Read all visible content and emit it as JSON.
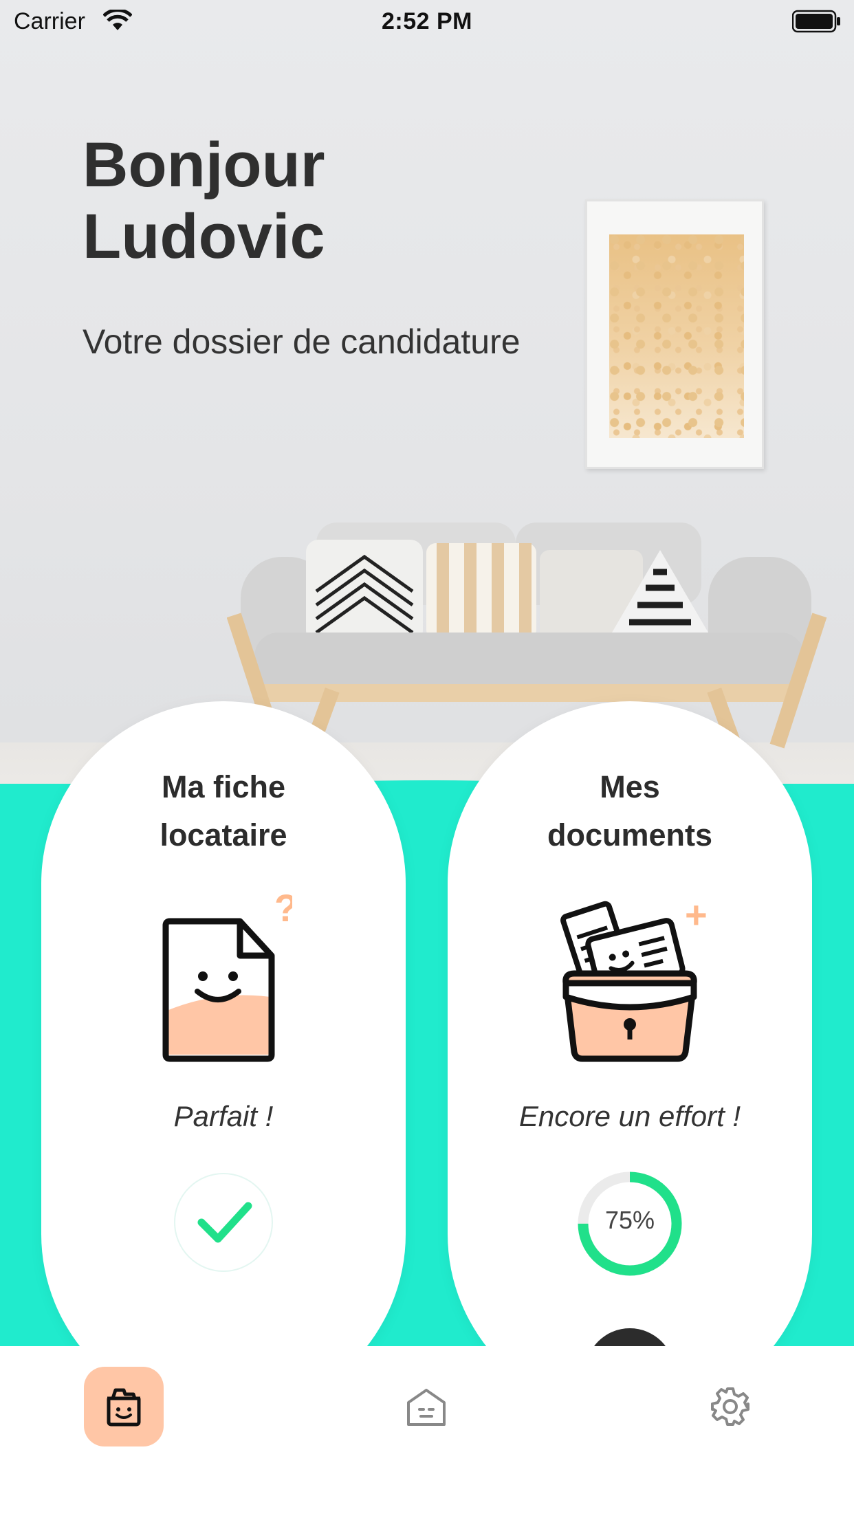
{
  "status_bar": {
    "carrier": "Carrier",
    "time": "2:52 PM"
  },
  "greeting": {
    "line1": "Bonjour",
    "line2": "Ludovic",
    "subtitle": "Votre dossier de candidature"
  },
  "cards": [
    {
      "title_line1": "Ma fiche",
      "title_line2": "locataire",
      "status": "Parfait !",
      "indicator": "check-icon"
    },
    {
      "title_line1": "Mes",
      "title_line2": "documents",
      "status": "Encore un effort !",
      "progress_label": "75%",
      "progress_value": 0.75
    }
  ],
  "tabbar": {
    "items": [
      "dossier-icon",
      "house-icon",
      "gear-icon"
    ],
    "active": "dossier-icon"
  },
  "colors": {
    "teal": "#20ebcd",
    "peach": "#ffc6a6",
    "green": "#20e08a",
    "accent_orange": "#ffb98c"
  }
}
